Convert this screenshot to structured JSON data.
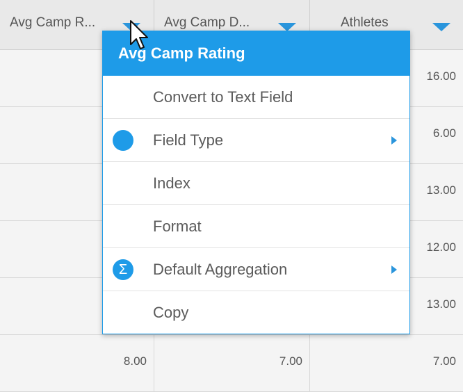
{
  "table": {
    "headers": [
      "Avg Camp R...",
      "Avg Camp D...",
      "Athletes"
    ],
    "rows": [
      [
        "",
        "",
        "16.00"
      ],
      [
        "",
        "",
        "6.00"
      ],
      [
        "",
        "",
        "13.00"
      ],
      [
        "",
        "",
        "12.00"
      ],
      [
        "",
        "",
        "13.00"
      ],
      [
        "8.00",
        "7.00",
        "7.00"
      ]
    ]
  },
  "menu": {
    "title": "Avg Camp Rating",
    "items": [
      {
        "label": "Convert to Text Field",
        "icon": ""
      },
      {
        "label": "Field Type",
        "icon": "circle-icon"
      },
      {
        "label": "Index",
        "icon": ""
      },
      {
        "label": "Format",
        "icon": ""
      },
      {
        "label": "Default Aggregation",
        "icon": "sigma-icon",
        "icon_glyph": "Σ"
      },
      {
        "label": "Copy",
        "icon": ""
      }
    ]
  },
  "colors": {
    "accent": "#1e9be8",
    "header_bg": "#e9e9e9",
    "cell_bg": "#f4f4f4"
  }
}
